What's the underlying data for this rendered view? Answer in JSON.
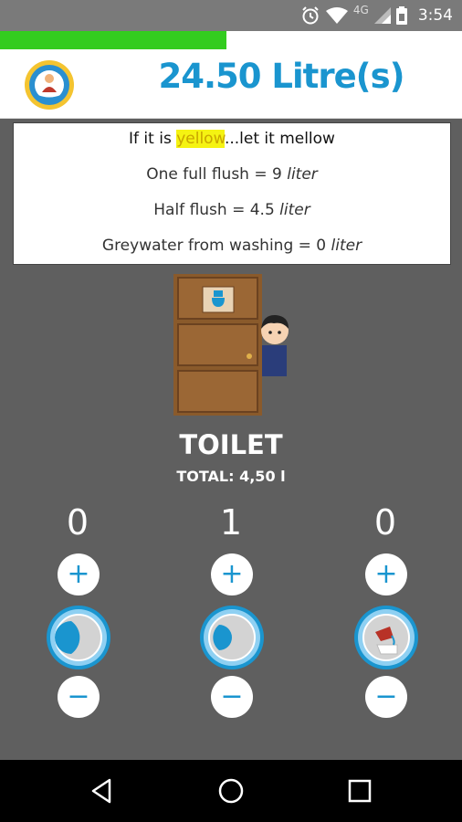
{
  "status_bar": {
    "network": "4G",
    "time": "3:54"
  },
  "progress": {
    "fraction": 0.49,
    "color": "#33cc1f"
  },
  "header": {
    "title": "24.50 Litre(s)",
    "title_color": "#1a95cf"
  },
  "info": {
    "line1_prefix": "If it is ",
    "line1_highlight": "yellow",
    "line1_suffix": "...let it mellow",
    "full_flush_label": "One full flush = 9 ",
    "full_flush_unit": "liter",
    "half_flush_label": "Half flush = 4.5 ",
    "half_flush_unit": "liter",
    "greywater_label": "Greywater from washing = 0 ",
    "greywater_unit": "liter"
  },
  "room": {
    "title": "TOILET",
    "total": "TOTAL: 4,50 l"
  },
  "counters": [
    {
      "value": "0",
      "plus": "+",
      "minus": "−",
      "icon": "full-flush-icon"
    },
    {
      "value": "1",
      "plus": "+",
      "minus": "−",
      "icon": "half-flush-icon"
    },
    {
      "value": "0",
      "plus": "+",
      "minus": "−",
      "icon": "greywater-bucket-icon"
    }
  ],
  "colors": {
    "background": "#5f5f5f",
    "accent": "#1a95cf",
    "highlight": "#f5f312"
  }
}
